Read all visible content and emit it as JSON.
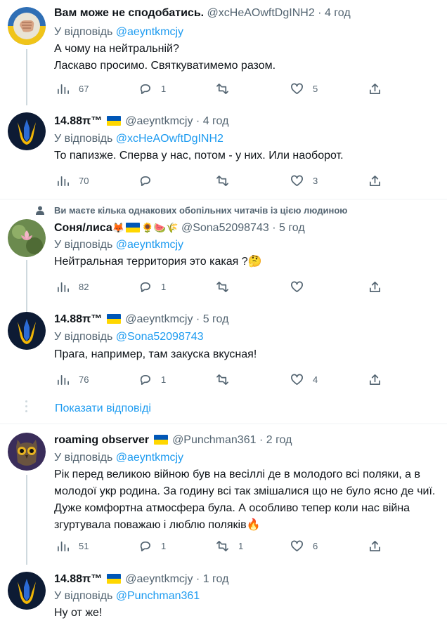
{
  "colors": {
    "link": "#1d9bf0",
    "secondary": "#536471",
    "flag_blue": "#0057b7",
    "flag_yellow": "#ffd700"
  },
  "show_replies": "Показати відповіді",
  "social_context": "Ви маєте кілька однакових обопільних читачів із цією людиною",
  "reply_prefix": "У відповідь",
  "tweets": [
    {
      "name": "Вам може не сподобатись.",
      "handle": "@xcHeAOwftDgINH2",
      "time": "· 4 год",
      "reply_to": "@aeyntkmcjy",
      "text_lines": [
        "А чому на нейтральній?",
        "Ласкаво просимо. Святкуватимемо разом."
      ],
      "views": "67",
      "replies": "1",
      "retweets": "",
      "likes": "5"
    },
    {
      "name": "14.88π™",
      "handle": "@aeyntkmcjy",
      "time": "· 4 год",
      "reply_to": "@xcHeAOwftDgINH2",
      "text_lines": [
        "То папизже. Сперва у нас, потом - у них. Или наоборот."
      ],
      "views": "70",
      "replies": "",
      "retweets": "",
      "likes": "3"
    },
    {
      "name": "Соня/лиса",
      "name_emoji": "🦊",
      "name_emoji_tail": "🌻🍉🌾",
      "handle": "@Sona52098743",
      "time": "· 5 год",
      "reply_to": "@aeyntkmcjy",
      "text_lines": [
        "Нейтральная территория это какая ?🤔"
      ],
      "views": "82",
      "replies": "1",
      "retweets": "",
      "likes": ""
    },
    {
      "name": "14.88π™",
      "handle": "@aeyntkmcjy",
      "time": "· 5 год",
      "reply_to": "@Sona52098743",
      "text_lines": [
        "Прага, например, там закуска вкусная!"
      ],
      "views": "76",
      "replies": "1",
      "retweets": "",
      "likes": "4"
    },
    {
      "name": "roaming observer",
      "handle": "@Punchman361",
      "time": "· 2 год",
      "reply_to": "@aeyntkmcjy",
      "text_lines": [
        "Рік перед великою війною був на весіллі де в молодого всі поляки, а в молодої укр родина. За годину всі так змішалися що не було ясно де чиї. Дуже комфортна атмосфера була. А особливо тепер коли нас війна згуртувала поважаю і люблю поляків🔥"
      ],
      "views": "51",
      "replies": "1",
      "retweets": "1",
      "likes": "6"
    },
    {
      "name": "14.88π™",
      "handle": "@aeyntkmcjy",
      "time": "· 1 год",
      "reply_to": "@Punchman361",
      "text_lines": [
        "Ну от же!"
      ]
    }
  ]
}
